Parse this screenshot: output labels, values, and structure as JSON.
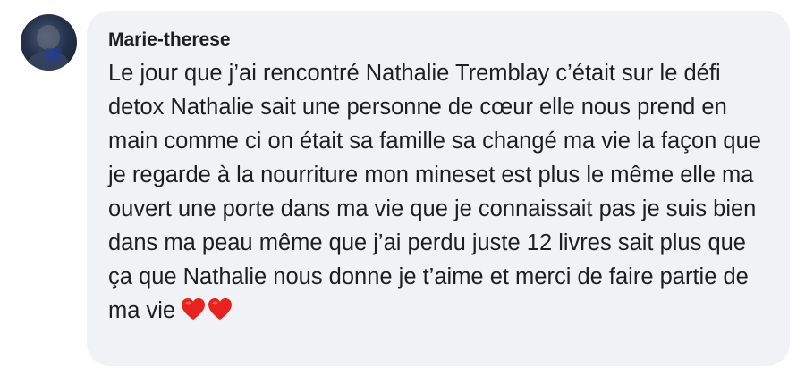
{
  "comment": {
    "author": "Marie-therese",
    "text": "Le jour que j’ai rencontré Nathalie Tremblay c’était sur le défi detox Nathalie sait une personne de cœur elle nous prend en main comme ci on était sa famille sa changé ma vie la façon que je regarde à la nourriture mon mineset est plus le même elle ma ouvert une porte dans ma vie que je connaissait pas je suis bien dans ma peau même que j’ai perdu juste 12 livres sait plus que ça que Nathalie nous donne je t’aime et merci de faire partie de ma vie",
    "emojis": [
      "red-heart",
      "red-heart"
    ]
  },
  "colors": {
    "bubble_background": "#f0f2f5",
    "text": "#1c1e21",
    "heart": "#e8231f"
  }
}
